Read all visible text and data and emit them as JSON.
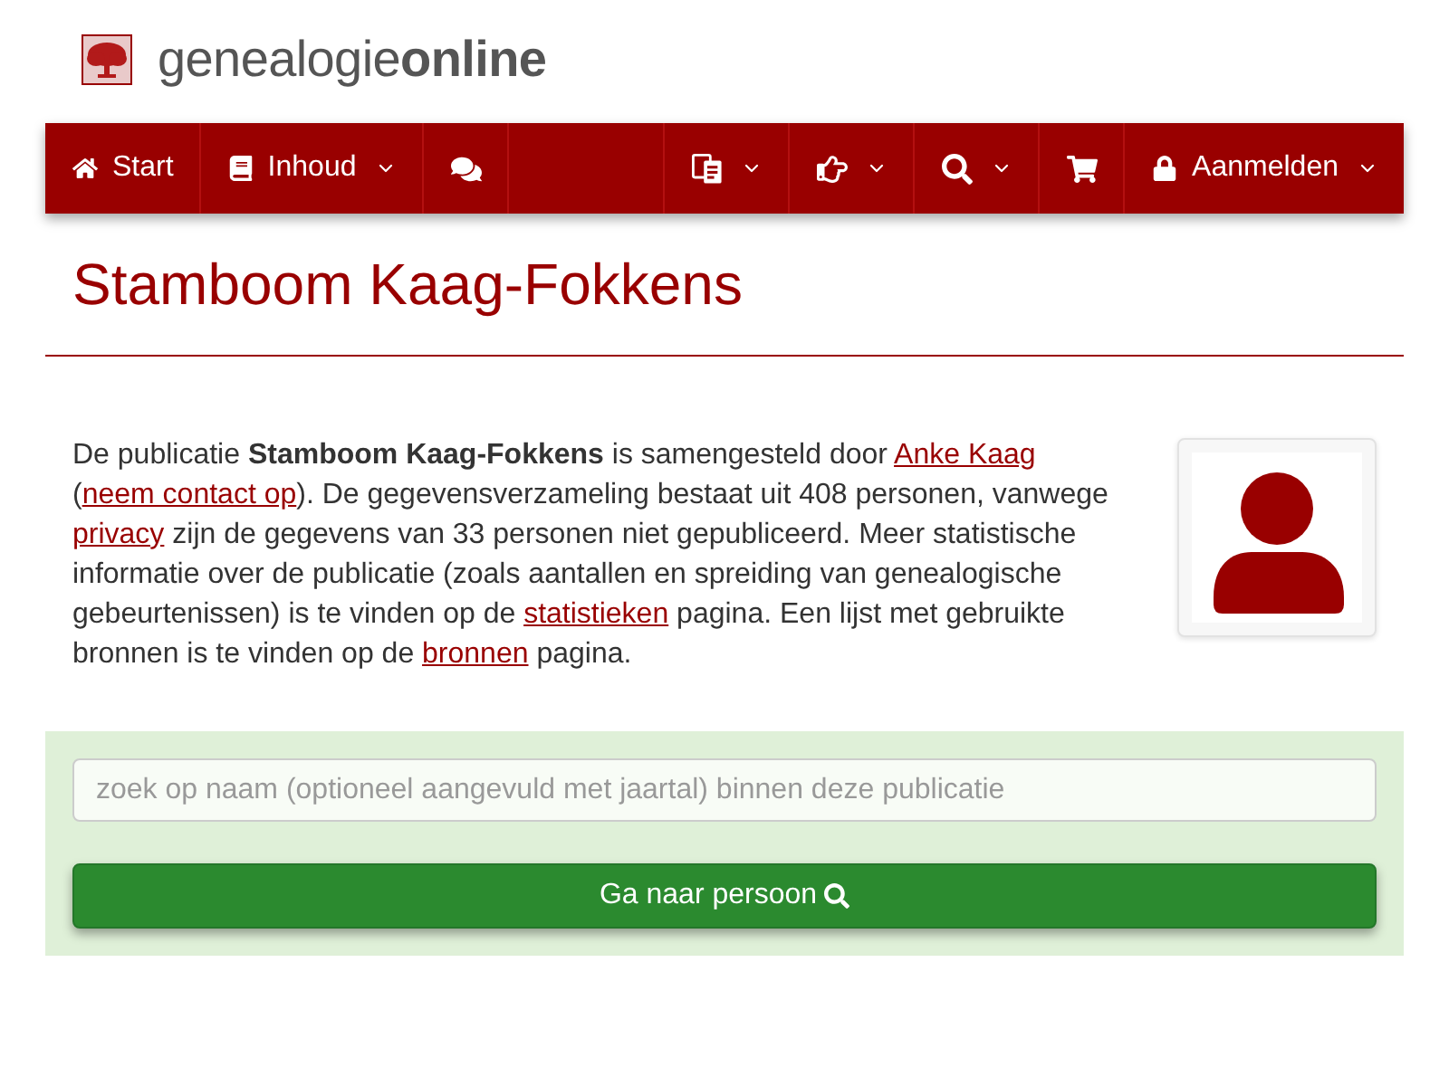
{
  "header": {
    "logo_text": "genealogie**online**"
  },
  "nav": {
    "left": [
      {
        "kind": "link",
        "label": "Start",
        "dropdown": false
      },
      {
        "kind": "link",
        "label": "Inhoud",
        "dropdown": true
      },
      {
        "kind": "icon",
        "dropdown": false
      }
    ],
    "right": [
      {
        "kind": "icon",
        "dropdown": true
      },
      {
        "kind": "icon",
        "dropdown": true
      },
      {
        "kind": "icon",
        "dropdown": true
      },
      {
        "kind": "icon",
        "dropdown": false
      },
      {
        "kind": "link",
        "label": "Aanmelden",
        "dropdown": true
      }
    ]
  },
  "title": "Stamboom Kaag-Fokkens",
  "intro": {
    "segments": [
      {
        "kind": "text",
        "text": "De publicatie **Stamboom Kaag-Fokkens** is samengesteld door "
      },
      {
        "kind": "link",
        "text": "Anke Kaag"
      },
      {
        "kind": "text",
        "text": " ("
      },
      {
        "kind": "link",
        "text": "neem contact op"
      },
      {
        "kind": "text",
        "text": "). De gegevensverzameling bestaat uit 408 personen, vanwege "
      },
      {
        "kind": "link",
        "text": "privacy"
      },
      {
        "kind": "text",
        "text": " zijn de gegevens van 33 personen niet gepubliceerd. Meer statistische informatie over de publicatie (zoals aantallen en spreiding van genealogische gebeurtenissen) is te vinden op de "
      },
      {
        "kind": "link",
        "text": "statistieken"
      },
      {
        "kind": "text",
        "text": " pagina. Een lijst met gebruikte bronnen is te vinden op de "
      },
      {
        "kind": "link",
        "text": "bronnen"
      },
      {
        "kind": "text",
        "text": " pagina."
      }
    ]
  },
  "search": {
    "placeholder": "zoek op naam (optioneel aangevuld met jaartal) binnen deze publicatie",
    "button": "Ga naar persoon"
  }
}
